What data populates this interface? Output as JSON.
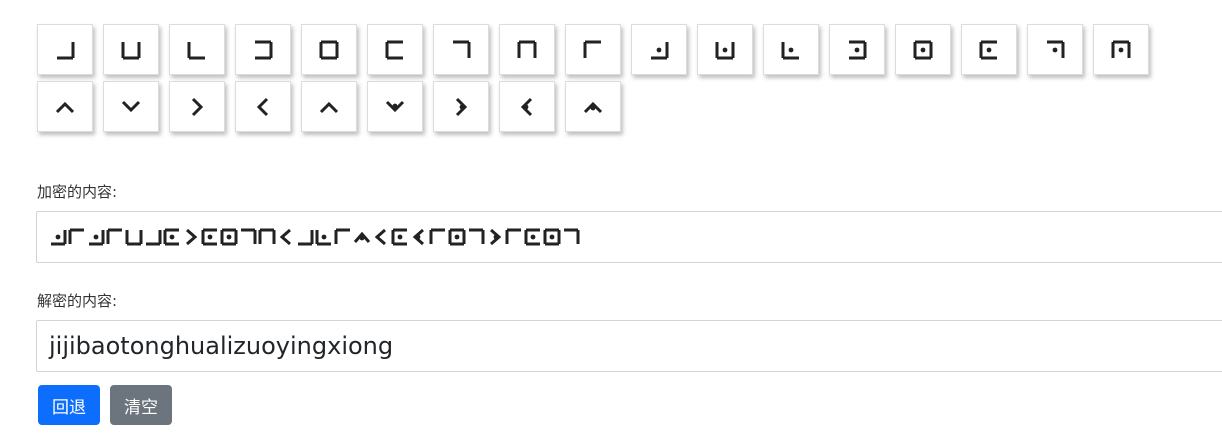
{
  "keys": {
    "row1": [
      "a",
      "b",
      "c",
      "d",
      "e",
      "f",
      "g",
      "h",
      "i",
      "j",
      "k",
      "l",
      "m",
      "n",
      "o",
      "p",
      "q"
    ],
    "row2": [
      "r",
      "s",
      "t",
      "u",
      "v",
      "w",
      "x",
      "y",
      "z"
    ]
  },
  "cipher_label": "加密的内容:",
  "cipher_text": "jijibaotonghualizuoyingxiong",
  "plain_label": "解密的内容:",
  "plain_text": "jijibaotonghualizuoyingxiong",
  "buttons": {
    "back": "回退",
    "clear": "清空"
  },
  "colors": {
    "primary": "#0d6efd",
    "secondary": "#6c757d"
  }
}
